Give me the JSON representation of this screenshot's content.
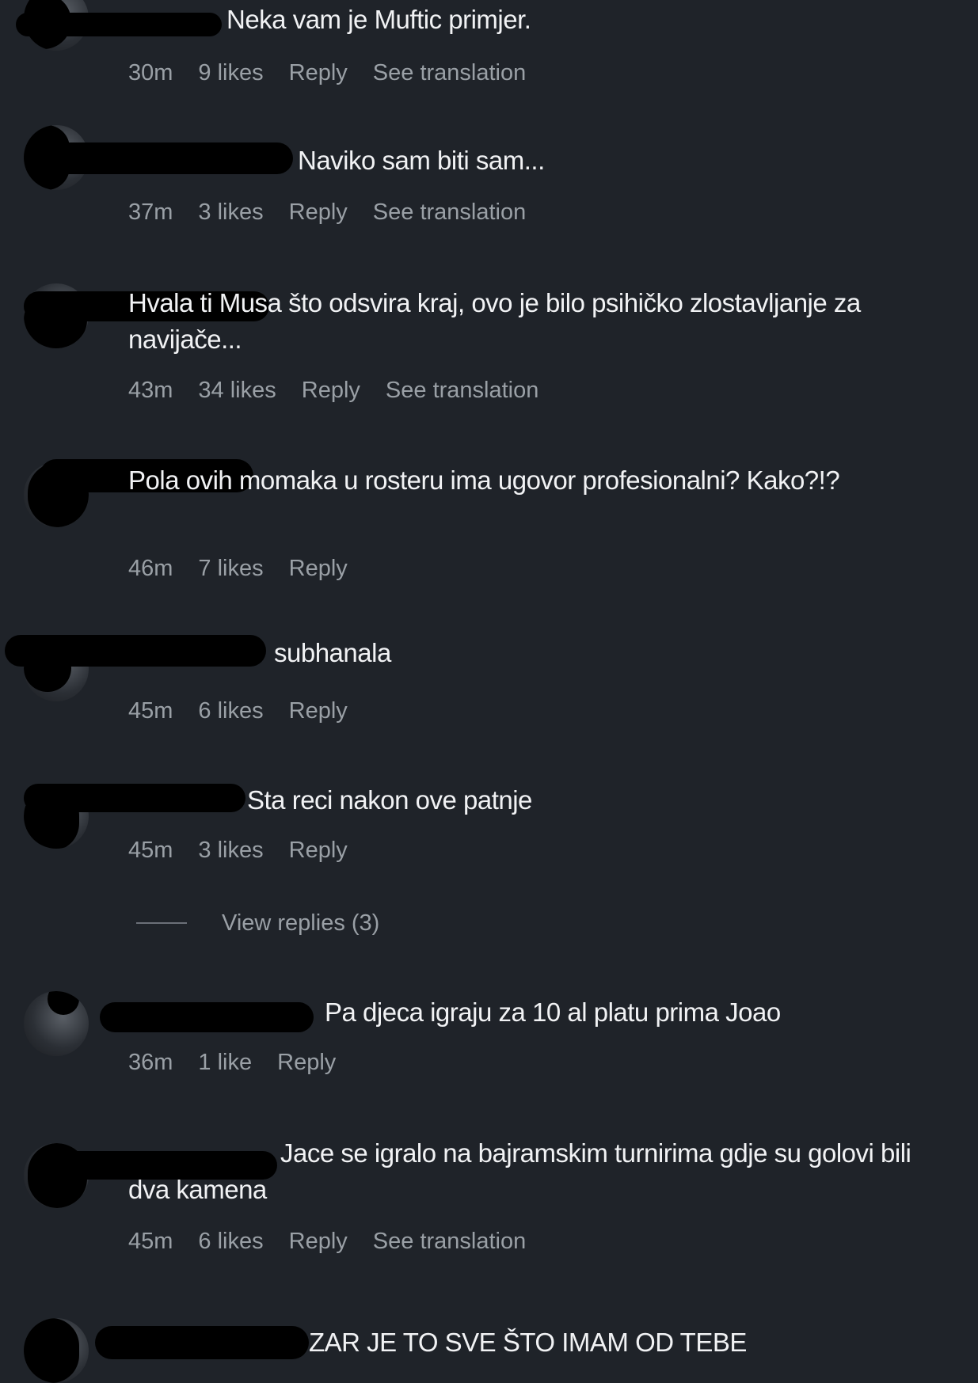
{
  "labels": {
    "reply": "Reply",
    "see_translation": "See translation"
  },
  "comments": [
    {
      "text": "Neka vam je Muftic primjer.",
      "time": "30m",
      "likes": "9 likes"
    },
    {
      "text": "Naviko sam biti sam...",
      "time": "37m",
      "likes": "3 likes"
    },
    {
      "text": "Hvala ti Musa što odsvira kraj, ovo je bilo psihičko zlostavljanje za navijače...",
      "time": "43m",
      "likes": "34 likes"
    },
    {
      "text": "Pola ovih momaka u rosteru ima ugovor profesionalni? Kako?!?",
      "time": "46m",
      "likes": "7 likes"
    },
    {
      "text": "subhanala",
      "time": "45m",
      "likes": "6 likes"
    },
    {
      "text": "Sta reci nakon ove patnje",
      "time": "45m",
      "likes": "3 likes"
    },
    {
      "text": "Pa djeca igraju za 10 al platu prima Joao",
      "time": "36m",
      "likes": "1 like"
    },
    {
      "text": "Jace se igralo na bajramskim turnirima gdje su golovi bili dva kamena",
      "time": "45m",
      "likes": "6 likes"
    },
    {
      "text": "ZAR JE TO SVE ŠTO IMAM OD TEBE"
    }
  ],
  "view_replies": "View replies (3)"
}
